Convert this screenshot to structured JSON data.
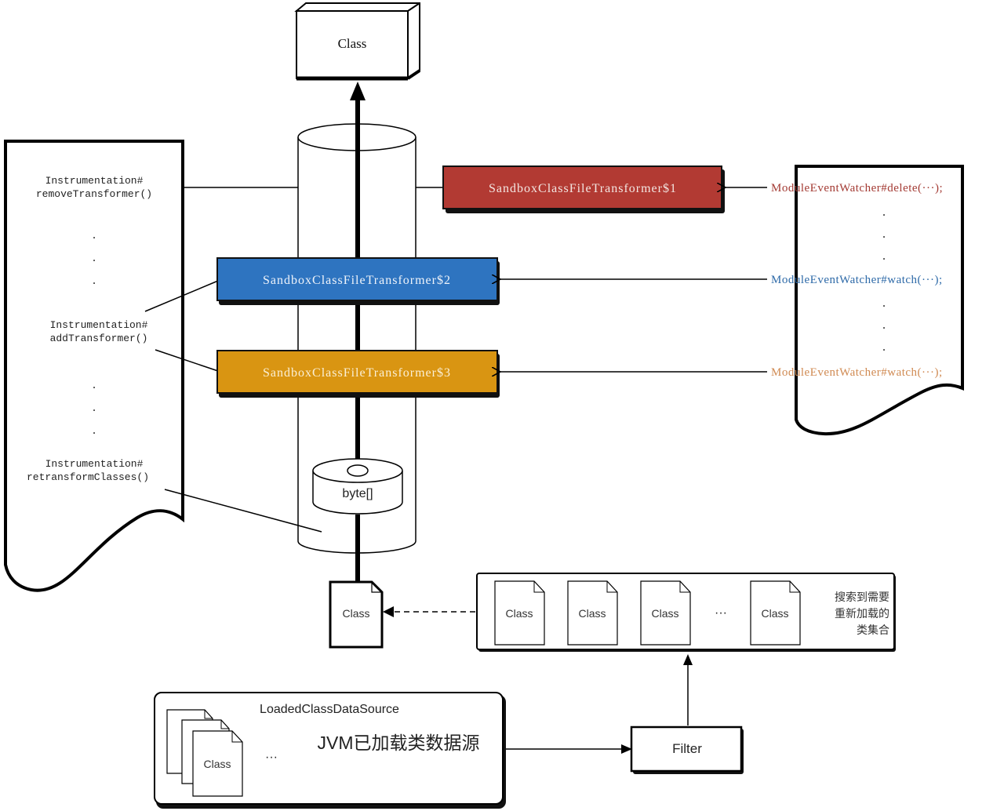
{
  "diagram": {
    "top_class": {
      "label": "Class"
    },
    "left_doc": {
      "remove": [
        "Instrumentation#",
        "removeTransformer()"
      ],
      "add": [
        "Instrumentation#",
        "addTransformer()"
      ],
      "retransform": [
        "Instrumentation#",
        "retransformClasses()"
      ],
      "ellipsis": "."
    },
    "transformers": [
      {
        "label": "SandboxClassFileTransformer$1",
        "color": "#b23a33"
      },
      {
        "label": "SandboxClassFileTransformer$2",
        "color": "#2e74c0"
      },
      {
        "label": "SandboxClassFileTransformer$3",
        "color": "#d99512"
      }
    ],
    "right_doc": {
      "calls": [
        {
          "label": "ModuleEventWatcher#delete(···);",
          "color": "#a33a33"
        },
        {
          "label": "ModuleEventWatcher#watch(···);",
          "color": "#2e6aa8"
        },
        {
          "label": "ModuleEventWatcher#watch(···);",
          "color": "#d08a52"
        }
      ],
      "ellipsis": "."
    },
    "byte_store": {
      "label": "byte[]"
    },
    "current_class": {
      "label": "Class"
    },
    "search_set": {
      "items": [
        "Class",
        "Class",
        "Class",
        "Class"
      ],
      "ellipsis": "···",
      "caption": [
        "搜索到需要",
        "重新加载的",
        "类集合"
      ]
    },
    "data_source": {
      "title": "LoadedClassDataSource",
      "subtitle": "JVM已加载类数据源",
      "stack_label": "Class",
      "ellipsis": "···"
    },
    "filter": {
      "label": "Filter"
    }
  }
}
